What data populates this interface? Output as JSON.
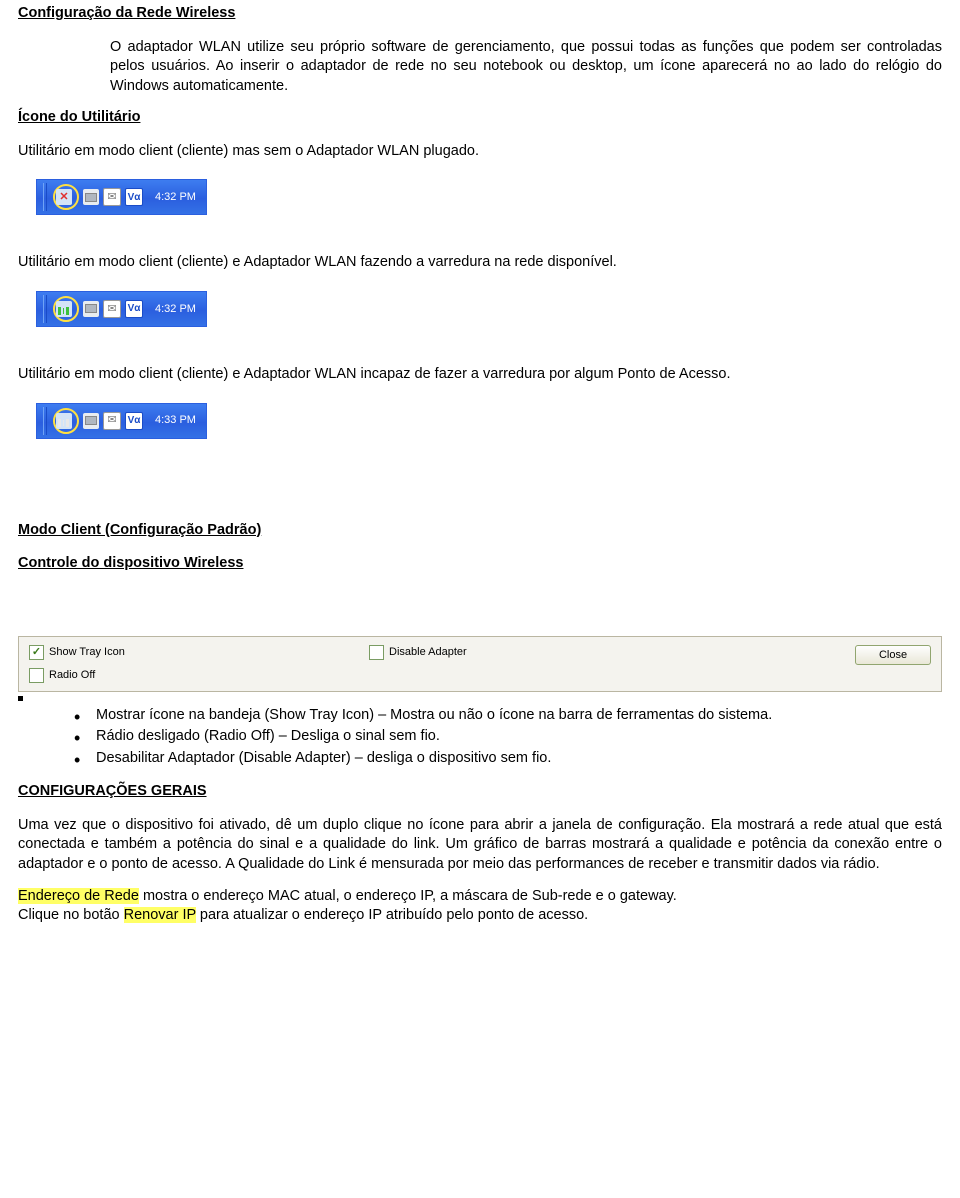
{
  "h1": "Configuração da Rede Wireless",
  "p1": "O adaptador WLAN utilize seu próprio software de gerenciamento, que possui todas as funções que podem ser controladas pelos usuários. Ao inserir o adaptador de rede no seu notebook ou desktop, um ícone aparecerá no ao lado do relógio do Windows automaticamente.",
  "h2": "Ícone do Utilitário",
  "p2": "Utilitário em modo client (cliente) mas sem o Adaptador WLAN plugado.",
  "p3": "Utilitário em modo client (cliente) e Adaptador WLAN fazendo a varredura na rede disponível.",
  "p4": "Utilitário em modo client (cliente) e Adaptador WLAN incapaz de fazer a varredura por algum Ponto de Acesso.",
  "tray": {
    "time1": "4:32 PM",
    "time2": "4:32 PM",
    "time3": "4:33 PM"
  },
  "h3": "Modo Client (Configuração Padrão)",
  "h4": "Controle do dispositivo Wireless",
  "dialog": {
    "showTray": "Show Tray Icon",
    "radioOff": "Radio Off",
    "disableAdapter": "Disable Adapter",
    "close": "Close"
  },
  "bullets": {
    "b1": "Mostrar ícone na bandeja (Show Tray Icon) – Mostra ou não o ícone na barra de ferramentas do sistema.",
    "b2": "Rádio desligado (Radio Off) –  Desliga o sinal sem fio.",
    "b3": "Desabilitar Adaptador (Disable Adapter) – desliga o dispositivo sem fio."
  },
  "h5": "CONFIGURAÇÕES GERAIS",
  "p5": "Uma vez que o dispositivo foi ativado, dê um duplo clique no ícone para abrir a janela de configuração. Ela mostrará a rede atual que está conectada e também a potência do sinal e a qualidade do link. Um gráfico de barras mostrará a qualidade e potência da conexão entre o adaptador e o ponto de acesso. A Qualidade do Link é mensurada por meio das performances de receber e transmitir dados via rádio.",
  "addr": {
    "hl1": "Endereço de Rede",
    "rest1": " mostra o endereço MAC atual, o endereço IP, a máscara de Sub-rede e o gateway.",
    "pre2": "Clique no botão ",
    "hl2": "Renovar IP",
    "rest2": " para atualizar o endereço IP atribuído pelo ponto de acesso."
  }
}
